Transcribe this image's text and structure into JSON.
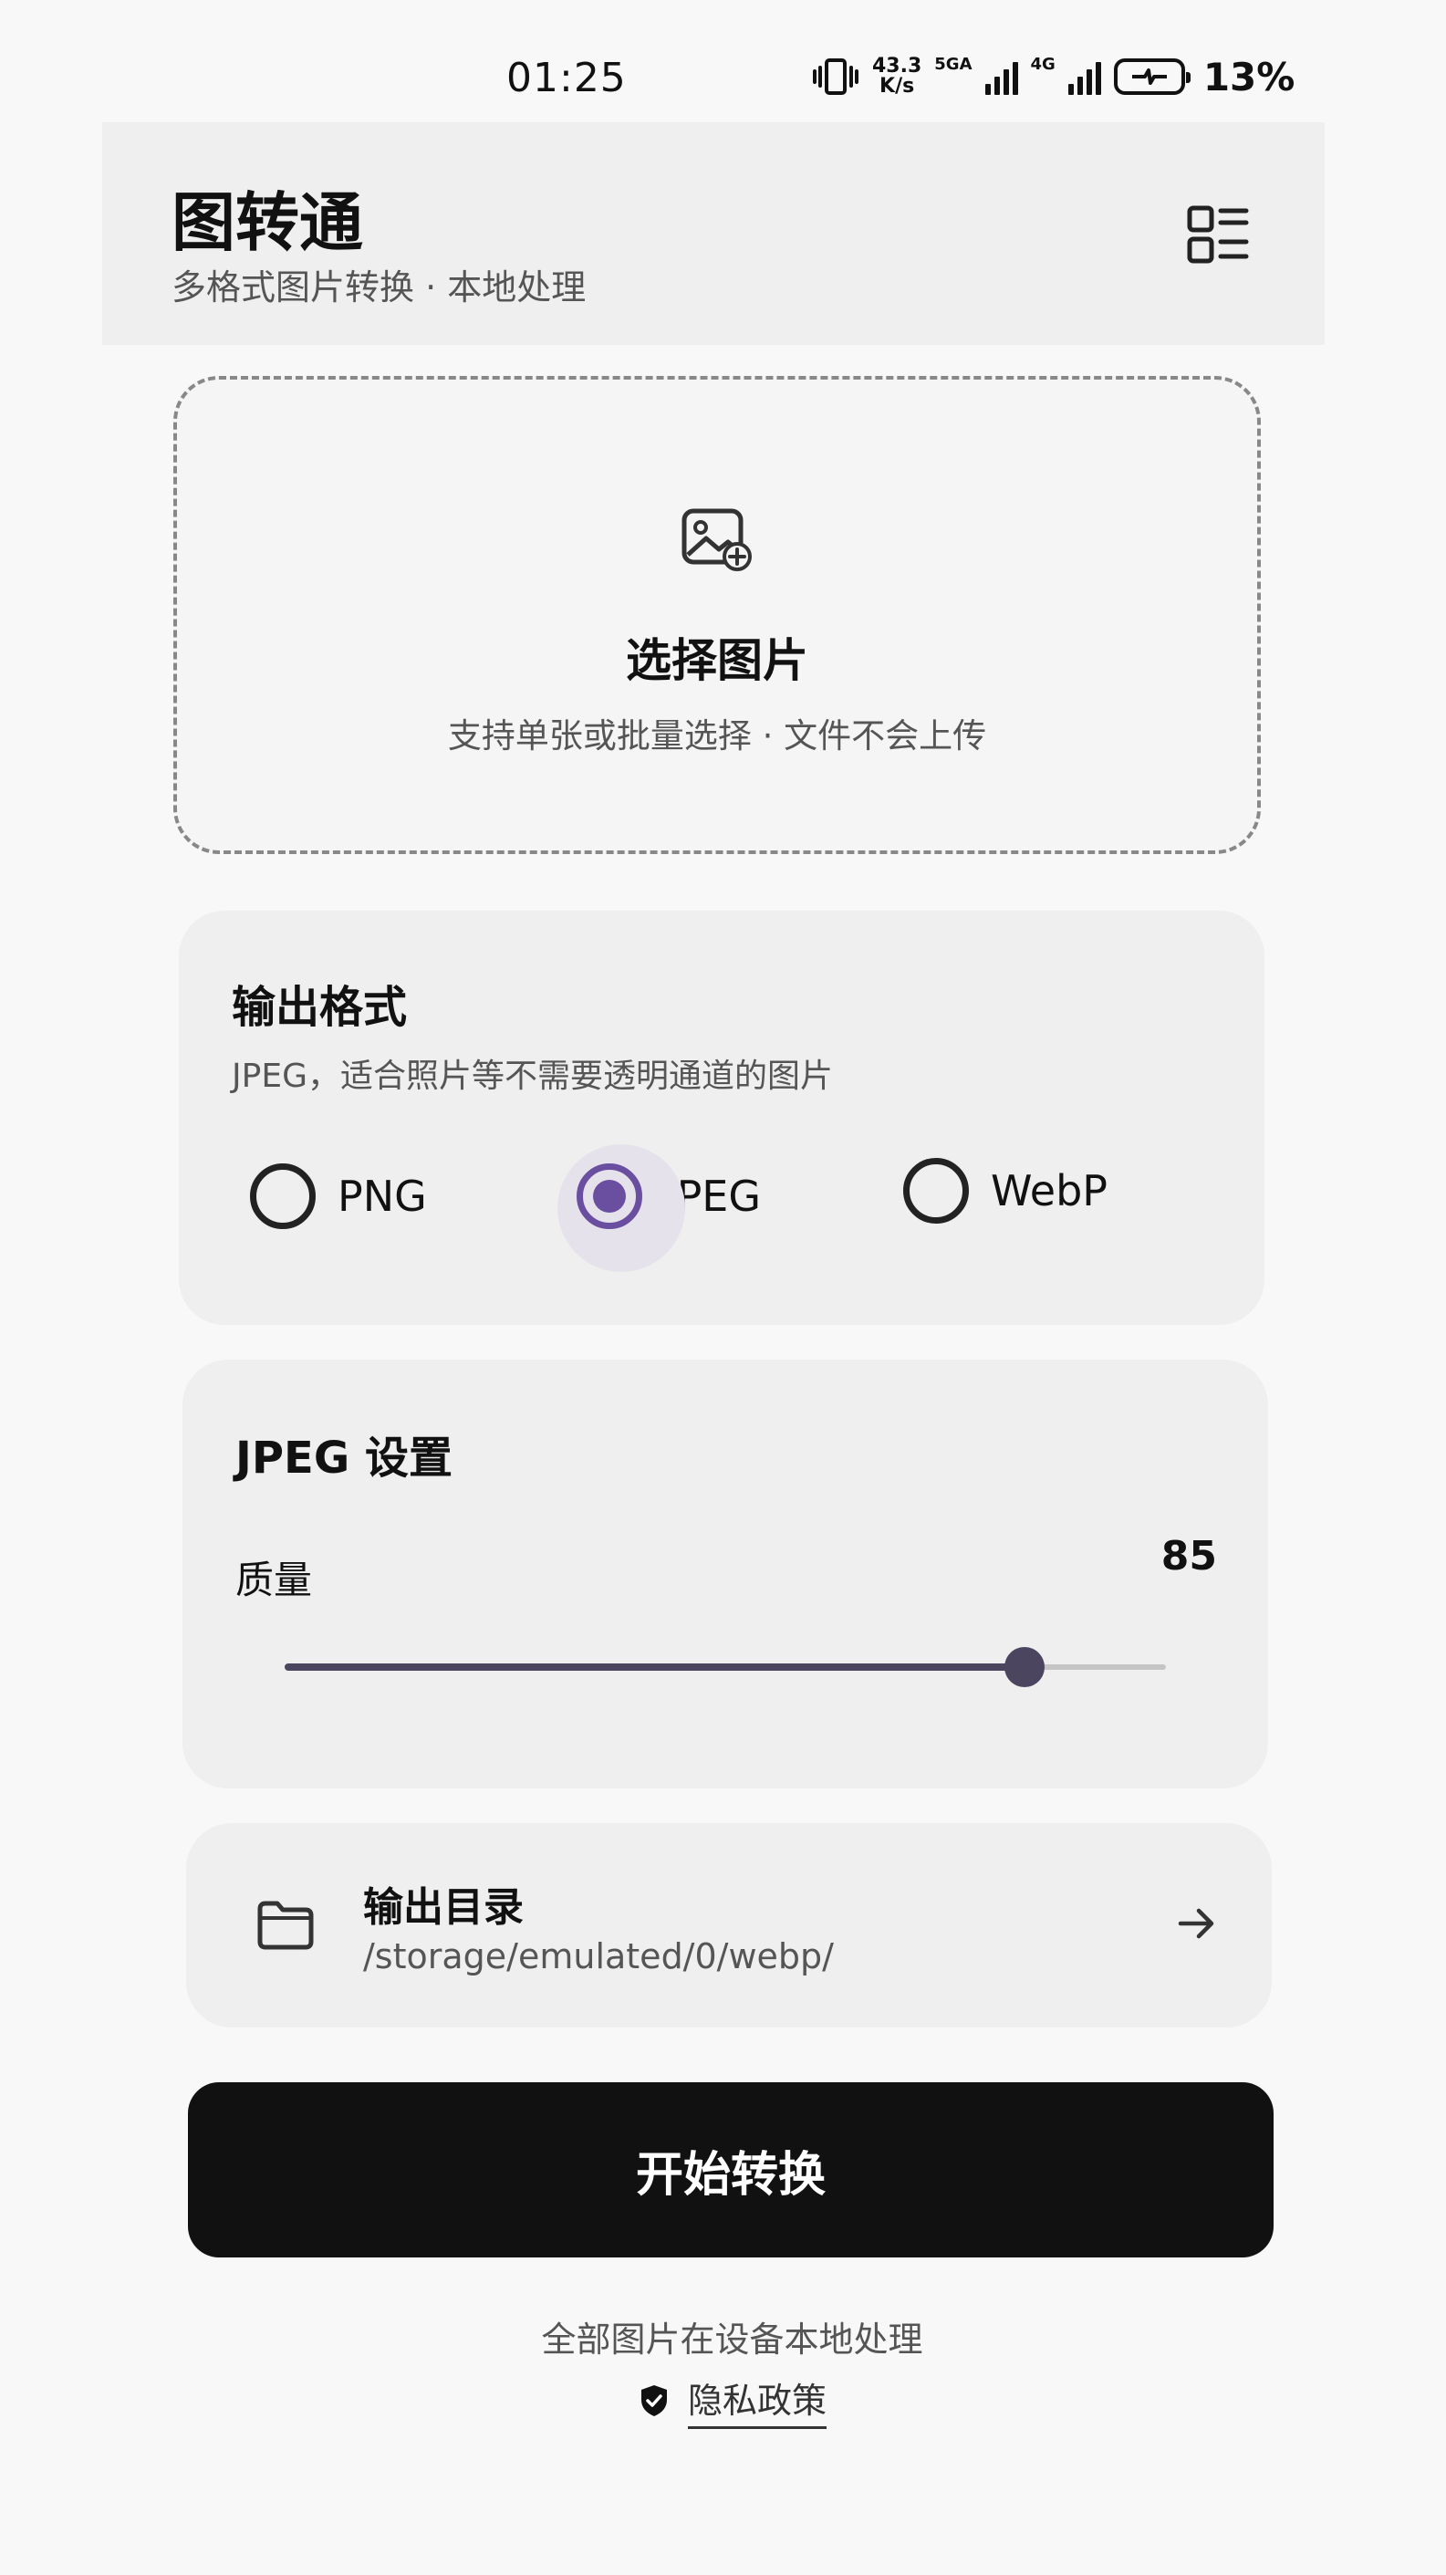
{
  "status_bar": {
    "time": "01:25",
    "net_speed_value": "43.3",
    "net_speed_unit": "K/s",
    "sim1_label": "5GA",
    "sim2_label": "4G",
    "battery": "13%"
  },
  "header": {
    "title": "图转通",
    "subtitle": "多格式图片转换 · 本地处理",
    "menu_icon": "grid-list-icon"
  },
  "picker": {
    "icon": "image-add-icon",
    "title": "选择图片",
    "hint": "支持单张或批量选择 · 文件不会上传"
  },
  "output_format": {
    "title": "输出格式",
    "description": "JPEG，适合照片等不需要透明通道的图片",
    "options": [
      {
        "label": "PNG",
        "selected": false
      },
      {
        "label": "JPEG",
        "selected": true
      },
      {
        "label": "WebP",
        "selected": false
      }
    ]
  },
  "jpeg_settings": {
    "title": "JPEG 设置",
    "quality_label": "质量",
    "quality_value": "85",
    "quality_fraction": 0.84
  },
  "output_dir": {
    "icon": "folder-icon",
    "title": "输出目录",
    "path": "/storage/emulated/0/webp/",
    "arrow_icon": "arrow-right-icon"
  },
  "start_button": "开始转换",
  "footer": {
    "note": "全部图片在设备本地处理",
    "privacy_icon": "shield-check-icon",
    "privacy_label": "隐私政策"
  },
  "colors": {
    "accent": "#6a4ea0",
    "slider": "#4b4560",
    "button": "#111111",
    "card": "#efefef"
  }
}
